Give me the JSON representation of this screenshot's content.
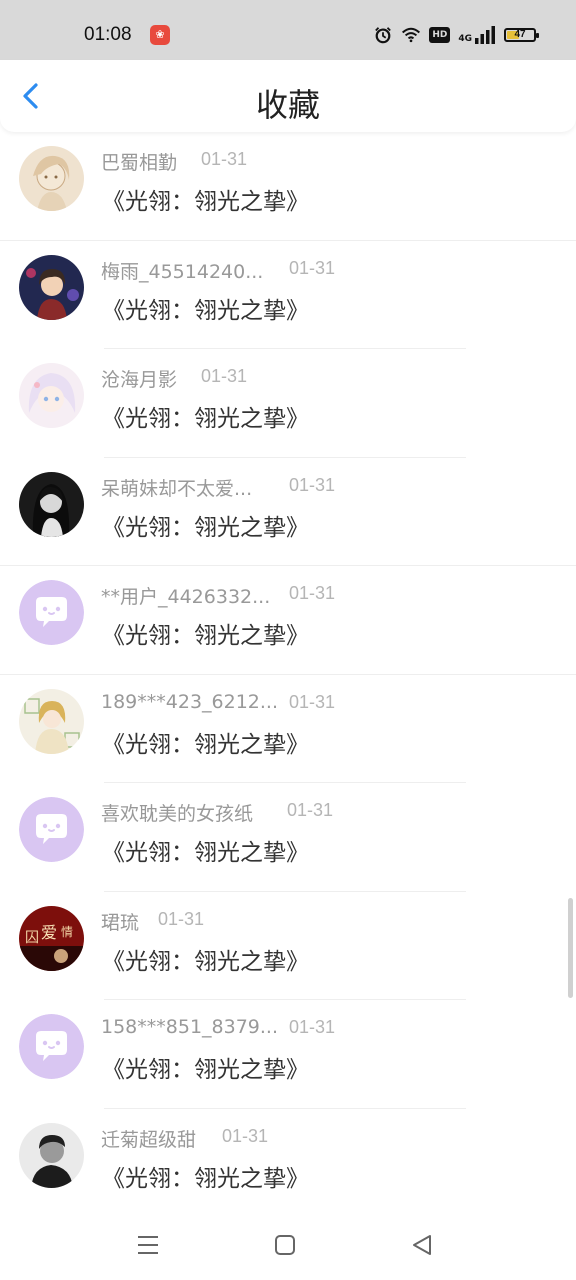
{
  "status_bar": {
    "time": "01:08",
    "app_badge": "app-notification-icon",
    "battery": 47,
    "network_label": "HD",
    "network_gen": "4G",
    "icons": [
      "alarm-icon",
      "wifi-icon",
      "hd-icon",
      "signal-icon",
      "battery-icon"
    ]
  },
  "header": {
    "title": "收藏",
    "back_icon": "chevron-left-icon"
  },
  "colors": {
    "accent": "#2d8cf0",
    "default_avatar": "#d9c6f2"
  },
  "items": [
    {
      "name": "巴蜀相勤",
      "date": "01-31",
      "book": "《光翎：翎光之挚》",
      "avatar": "sketch-girl"
    },
    {
      "name": "梅雨_45514240...",
      "date": "01-31",
      "book": "《光翎：翎光之挚》",
      "avatar": "anime-boy"
    },
    {
      "name": "沧海月影",
      "date": "01-31",
      "book": "《光翎：翎光之挚》",
      "avatar": "pastel-girl"
    },
    {
      "name": "呆萌妹却不太爱...",
      "date": "01-31",
      "book": "《光翎：翎光之挚》",
      "avatar": "dark-girl"
    },
    {
      "name": "**用户_4426332...",
      "date": "01-31",
      "book": "《光翎：翎光之挚》",
      "avatar": "default"
    },
    {
      "name": "189***423_6212...",
      "date": "01-31",
      "book": "《光翎：翎光之挚》",
      "avatar": "gold-girl"
    },
    {
      "name": "喜欢耽美的女孩纸",
      "date": "01-31",
      "book": "《光翎：翎光之挚》",
      "avatar": "default"
    },
    {
      "name": "珺琉",
      "date": "01-31",
      "book": "《光翎：翎光之挚》",
      "avatar": "red-poster"
    },
    {
      "name": "158***851_8379...",
      "date": "01-31",
      "book": "《光翎：翎光之挚》",
      "avatar": "default"
    },
    {
      "name": "迁菊超级甜",
      "date": "01-31",
      "book": "《光翎：翎光之挚》",
      "avatar": "bw-man"
    }
  ],
  "nav": {
    "menu": "menu-icon",
    "home": "home-icon",
    "back": "back-triangle-icon"
  }
}
